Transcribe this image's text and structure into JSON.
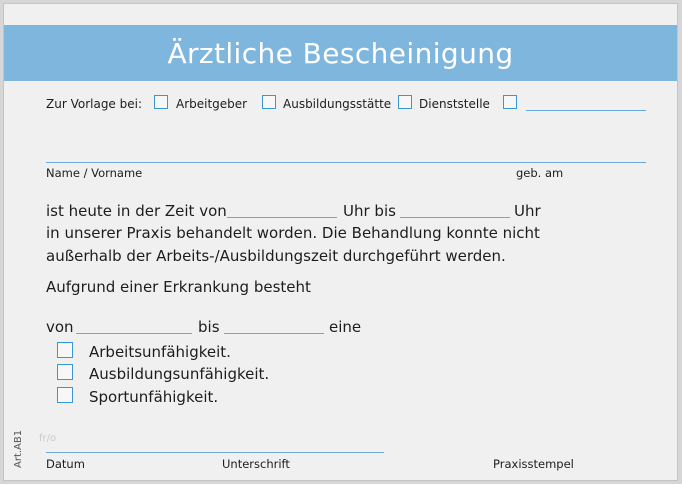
{
  "title": "Ärztliche Bescheinigung",
  "vorlage": {
    "label": "Zur Vorlage bei:",
    "options": [
      "Arbeitgeber",
      "Ausbildungsstätte",
      "Dienststelle"
    ]
  },
  "name_label": "Name / Vorname",
  "birth_label": "geb. am",
  "text": {
    "l1_a": "ist heute in der Zeit von",
    "l1_b": "Uhr bis",
    "l1_c": "Uhr",
    "l2": "in unserer Praxis behandelt worden. Die Behandlung konnte nicht",
    "l3": "außerhalb der Arbeits-/Ausbildungszeit durchgeführt werden.",
    "aufgrund": "Aufgrund einer Erkrankung besteht",
    "von": "von",
    "bis": "bis",
    "eine": "eine"
  },
  "conditions": [
    "Arbeitsunfähigkeit.",
    "Ausbildungsunfähigkeit.",
    "Sportunfähigkeit."
  ],
  "footer": {
    "faint": "fr/o",
    "datum": "Datum",
    "unterschrift": "Unterschrift",
    "stempel": "Praxisstempel",
    "art": "Art.AB1"
  },
  "colors": {
    "header": "#7fb6de",
    "line": "#6aa9d9",
    "checkbox": "#3b97d3"
  }
}
